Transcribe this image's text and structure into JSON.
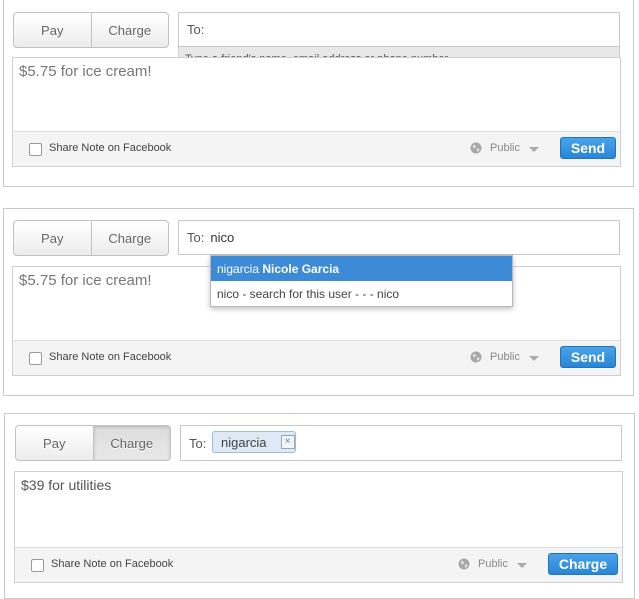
{
  "panels": [
    {
      "pay_label": "Pay",
      "charge_label": "Charge",
      "active_tab": "pay",
      "to_label": "To:",
      "to_value": "",
      "hint": "Type a friend's name, email address or phone number",
      "note": "$5.75 for ice cream!",
      "share_label": "Share Note on Facebook",
      "privacy_label": "Public",
      "action_label": "Send"
    },
    {
      "pay_label": "Pay",
      "charge_label": "Charge",
      "active_tab": "pay",
      "to_label": "To:",
      "to_value": "nico",
      "suggestion_user": "nigarcia",
      "suggestion_name": "Nicole Garcia",
      "suggestion_search": "nico - search for this user - - - nico",
      "note": "$5.75 for ice cream!",
      "share_label": "Share Note on Facebook",
      "privacy_label": "Public",
      "action_label": "Send"
    },
    {
      "pay_label": "Pay",
      "charge_label": "Charge",
      "active_tab": "charge",
      "to_label": "To:",
      "token": "nigarcia",
      "token_remove": "×",
      "note": "$39 for utilities",
      "share_label": "Share Note on Facebook",
      "privacy_label": "Public",
      "action_label": "Charge"
    }
  ],
  "colors": {
    "accent": "#2a86d6",
    "selection": "#3d8bd6"
  }
}
